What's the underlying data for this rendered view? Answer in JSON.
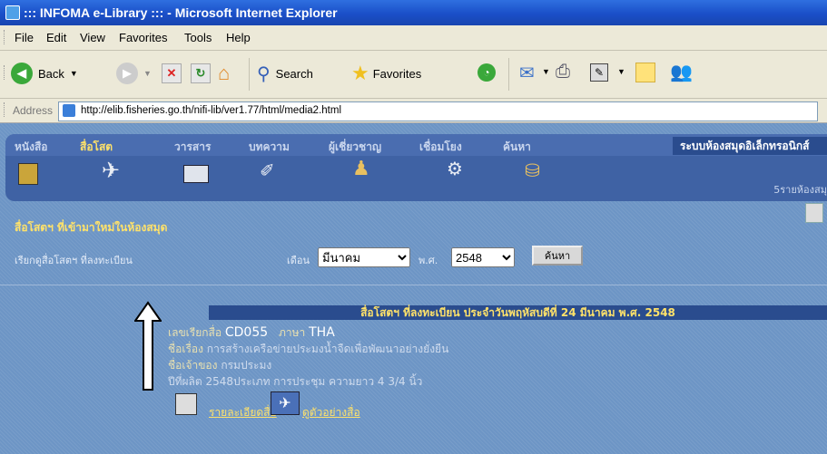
{
  "window": {
    "title": "::: INFOMA e-Library ::: - Microsoft Internet Explorer"
  },
  "menu": [
    "File",
    "Edit",
    "View",
    "Favorites",
    "Tools",
    "Help"
  ],
  "toolbar": {
    "back_label": "Back",
    "search_label": "Search",
    "favorites_label": "Favorites"
  },
  "address": {
    "label": "Address",
    "url": "http://elib.fisheries.go.th/nifi-lib/ver1.77/html/media2.html"
  },
  "site": {
    "tabs": [
      "หนังสือ",
      "สื่อโสต",
      "วารสาร",
      "บทความ",
      "ผู้เชี่ยวชาญ",
      "เชื่อมโยง",
      "ค้นหา"
    ],
    "active_tab": "สื่อโสต",
    "system_title": "ระบบห้องสมุดอิเล็กทรอนิกส์",
    "user_text": "5รายห้องสมุ"
  },
  "filter": {
    "headline": "สื่อโสตฯ ที่เข้ามาใหม่ในห้องสมุด",
    "label": "เรียกดูสื่อโสตฯ ที่ลงทะเบียน",
    "month_label": "เดือน",
    "month_value": "มีนาคม",
    "year_label": "พ.ศ.",
    "year_value": "2548",
    "search_button": "ค้นหา"
  },
  "listing": {
    "header": "สื่อโสตฯ ที่ลงทะเบียน ประจำวันพฤหัสบดีที่ 24 มีนาคม พ.ศ. 2548",
    "media_code_key": "เลขเรียกสื่อ",
    "media_code": "CD055",
    "lang_key": "ภาษา",
    "lang": "THA",
    "title_key": "ชื่อเรื่อง",
    "title_value": "การสร้างเครือข่ายประมงน้ำจืดเพื่อพัฒนาอย่างยั่งยืน",
    "owner_key": "ชื่อเจ้าของ",
    "owner_value": "กรมประมง",
    "meta_line": "ปีที่ผลิต 2548ประเภท การประชุม ความยาว 4 3/4 นิ้ว",
    "link_detail": "รายละเอียดสื่อ",
    "link_view": "ดูตัวอย่างสื่อ"
  }
}
